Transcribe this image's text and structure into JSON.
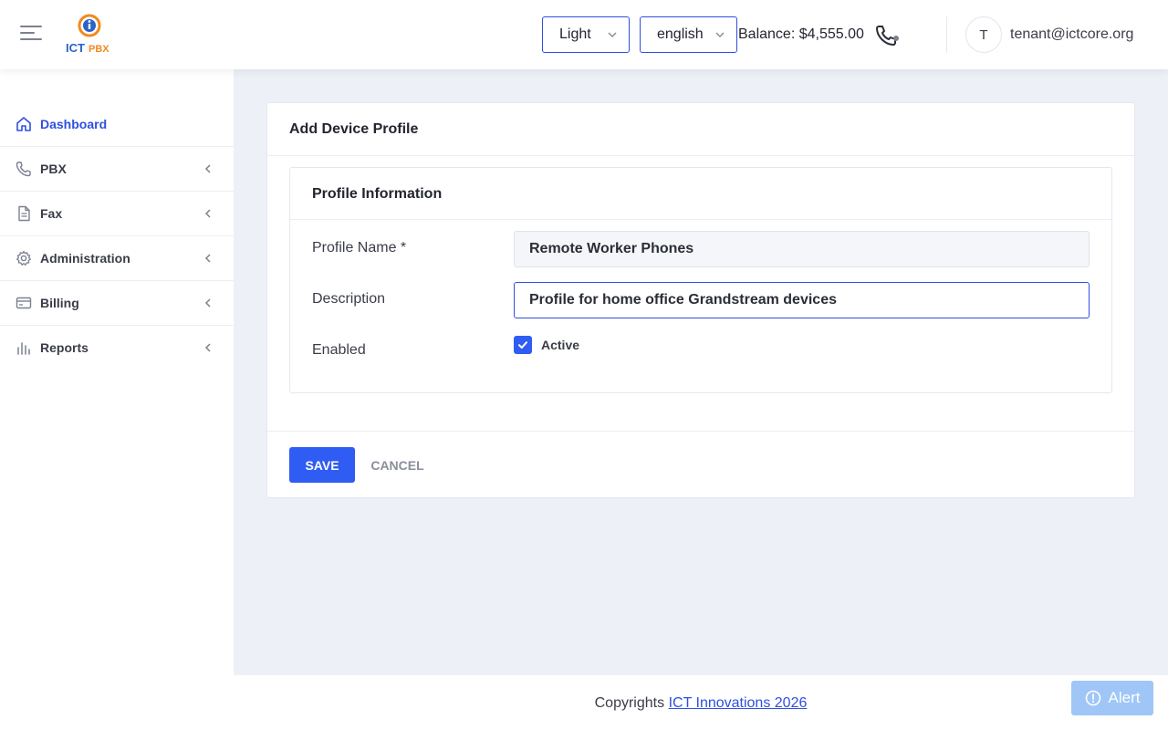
{
  "header": {
    "theme_select": {
      "value": "Light",
      "icon": "chevron-down-icon"
    },
    "language_select": {
      "value": "english",
      "icon": "chevron-down-icon"
    },
    "balance": "Balance: $4,555.00",
    "phone_icon": "phone-status-icon",
    "user": {
      "avatar_initial": "T",
      "email": "tenant@ictcore.org"
    }
  },
  "sidebar": {
    "items": [
      {
        "label": "Dashboard",
        "icon": "home-icon",
        "active": true
      },
      {
        "label": "PBX",
        "icon": "phone-icon"
      },
      {
        "label": "Fax",
        "icon": "document-icon"
      },
      {
        "label": "Administration",
        "icon": "gear-icon"
      },
      {
        "label": "Billing",
        "icon": "credit-card-icon"
      },
      {
        "label": "Reports",
        "icon": "bar-chart-icon"
      }
    ]
  },
  "form": {
    "title": "Add Device Profile",
    "section_title": "Profile Information",
    "fields": {
      "profile_name": {
        "label": "Profile Name *",
        "value": "Remote Worker Phones"
      },
      "description": {
        "label": "Description",
        "value": "Profile for home office Grandstream devices"
      },
      "enabled": {
        "label": "Enabled",
        "checkbox_label": "Active",
        "checked": true
      }
    },
    "buttons": {
      "save": "SAVE",
      "cancel": "CANCEL"
    }
  },
  "footer": {
    "copyright_prefix": "Copyrights",
    "copyright_link": "ICT Innovations 2026",
    "alert_button": "Alert"
  },
  "colors": {
    "accent": "#2f5cf2",
    "page_background": "#edf0f7",
    "alert_button": "#9fc6f7"
  }
}
